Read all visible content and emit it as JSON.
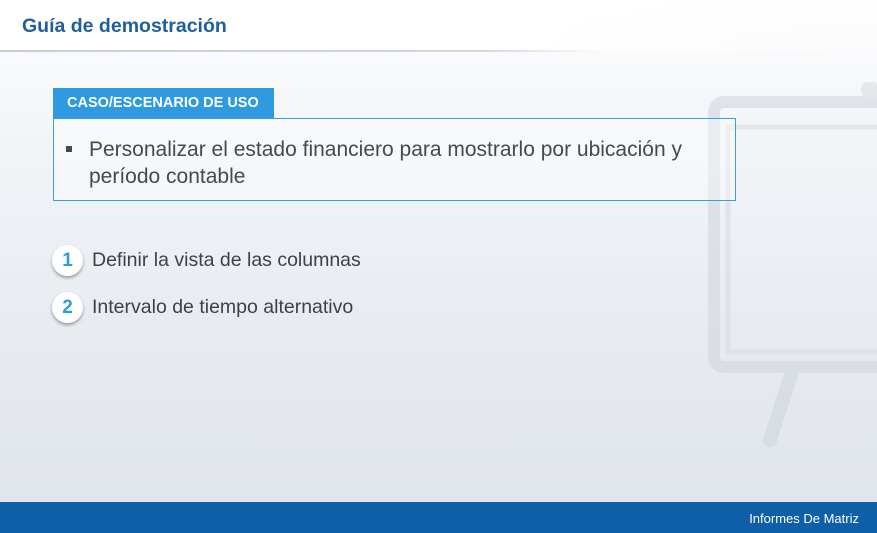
{
  "header": {
    "title": "Guía de demostración"
  },
  "case": {
    "tag": "CASO/ESCENARIO DE USO",
    "bullet": "Personalizar el estado financiero para mostrarlo por ubicación y período contable"
  },
  "steps": [
    {
      "number": "1",
      "label": "Definir la vista de las columnas"
    },
    {
      "number": "2",
      "label": "Intervalo de tiempo alternativo"
    }
  ],
  "footer": {
    "text": "Informes De Matriz"
  },
  "colors": {
    "title": "#1f5f9e",
    "accent": "#2f9ae0",
    "footer_bg": "#0f5ea8"
  },
  "icons": {
    "watermark": "presentation-board-icon"
  }
}
